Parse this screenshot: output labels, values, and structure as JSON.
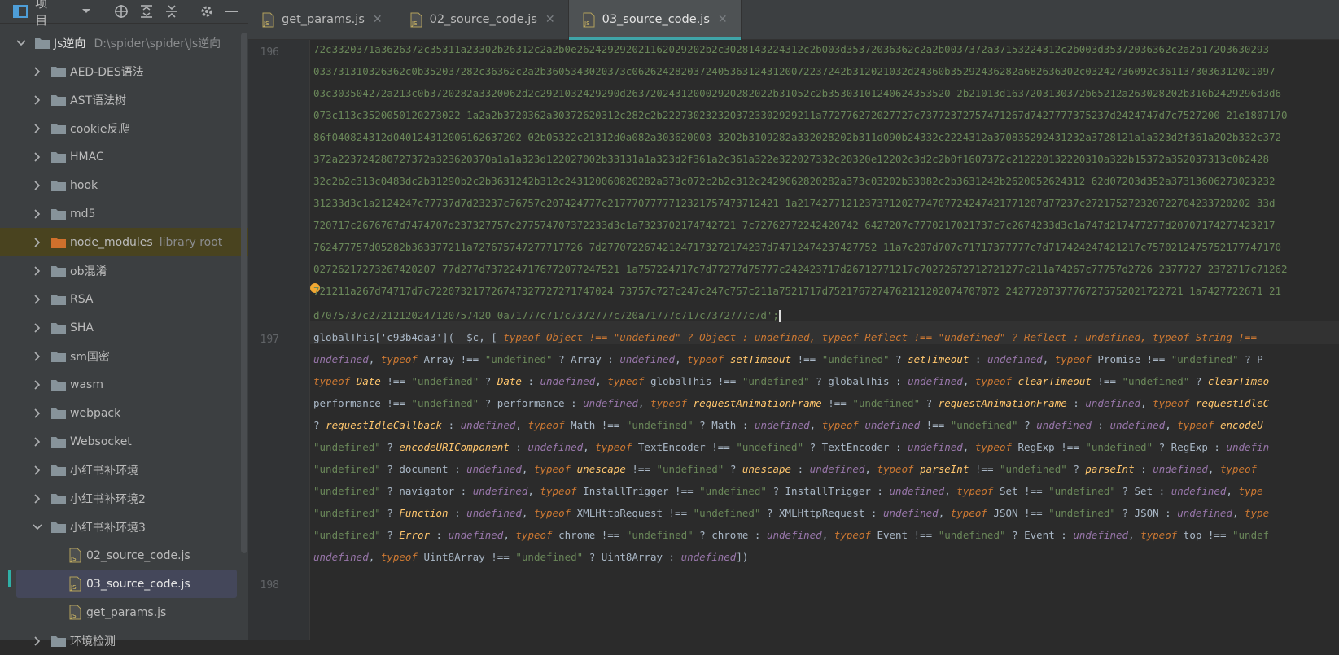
{
  "panel": {
    "title": "项目",
    "root": {
      "name": "Js逆向",
      "path": "D:\\spider\\spider\\Js逆向"
    },
    "folders": [
      "AED-DES语法",
      "AST语法树",
      "cookie反爬",
      "HMAC",
      "hook",
      "md5",
      "node_modules",
      "ob混淆",
      "RSA",
      "SHA",
      "sm国密",
      "wasm",
      "webpack",
      "Websocket",
      "小红书补环境",
      "小红书补环境2",
      "小红书补环境3"
    ],
    "library_root_label": "library root",
    "files": [
      "02_source_code.js",
      "03_source_code.js",
      "get_params.js"
    ],
    "next_folder": "环境检测"
  },
  "tabs": [
    {
      "label": "get_params.js"
    },
    {
      "label": "02_source_code.js"
    },
    {
      "label": "03_source_code.js"
    }
  ],
  "editor": {
    "line_numbers": [
      "196",
      "197",
      "198"
    ],
    "hex_lines": [
      "72c3320371a3626372c35311a23302b26312c2a2b0e262429292021162029202b2c3028143224312c2b003d35372036362c2a2b0037372a37153224312c2b003d35372036362c2a2b17203630293",
      "033731310326362c0b352037282c36362c2a2b3605343020373c06262428203724053631243120072237242b312021032d24360b35292436282a682636302c03242736092c3611373036312021097",
      "03c303504272a213c0b3720282a3320062d2c2921032429290d263720243120002920282022b31052c2b35303101240624353520 2b21013d1637203130372b65212a263028202b316b2429296d3d6",
      "073c113c3520050120273022 1a2a2b3720362a30372620312c282c2b2227302323203723302929211a772776272027727c73772372757471267d7427777375237d2424747d7c7527200 21e1807170",
      "86f040824312d040124312006162637202 02b05322c21312d0a082a303620003 3202b3109282a332028202b311d090b24332c2224312a370835292431232a3728121a1a323d2f361a202b332c372",
      "372a223724280727372a323620370a1a1a323d122027002b33131a1a323d2f361a2c361a322e322027332c20320e12202c3d2c2b0f1607372c212220132220310a322b15372a352037313c0b2428",
      "32c2b2c313c0483dc2b31290b2c2b3631242b312c243120060820282a373c072c2b2c312c2429062820282a373c03202b33082c2b3631242b2620052624312 62d07203d352a37313606273023232",
      "31233d3c1a2124247c77737d7d23237c76757c207424777c2177707777712321757473712421 1a2174277121237371202774707724247421771207d77237c272175272320722704233720202 33d",
      "720717c2676767d7474707d237327757c277574707372233d3c1a7323702174742721 7c72762772242420742 6427207c7770217021737c7c2674233d3c1a747d217477277d20707174277423217",
      "762477757d05282b363377211a727675747277717726 7d277072267421247173272174237d74712474237427752 11a7c207d707c71717377777c7d717424247421217c7570212475752177747170",
      "02726217273267420207 77d277d7372247176772077247521 1a757224717c7d77277d75777c242423717d26712771217c70272672712721277c211a74267c77757d2726 2377727 2372717c71262",
      "721211a267d74717d7c722073217726747327727271747024 73757c727c247c247c757c211a7521717d7521767274762121202074707072 24277207377767275752021722721 1a7427722671 21",
      "d7075737c27212120247120757420 0a71777c717c7372777c720a71777c717c7372777c7d';"
    ],
    "code_lines": [
      "globalThis['c93b4da3'](__$c, [",
      "typeof Object !== \"undefined\" ? Object : undefined, typeof Reflect !== \"undefined\" ? Reflect : undefined, typeof String !=="
    ]
  },
  "colors": {
    "accent": "#3fa4a8",
    "highlight_row": "#49431f",
    "string": "#6a8759",
    "keyword": "#cc7832",
    "global_fn": "#ffc66d"
  }
}
